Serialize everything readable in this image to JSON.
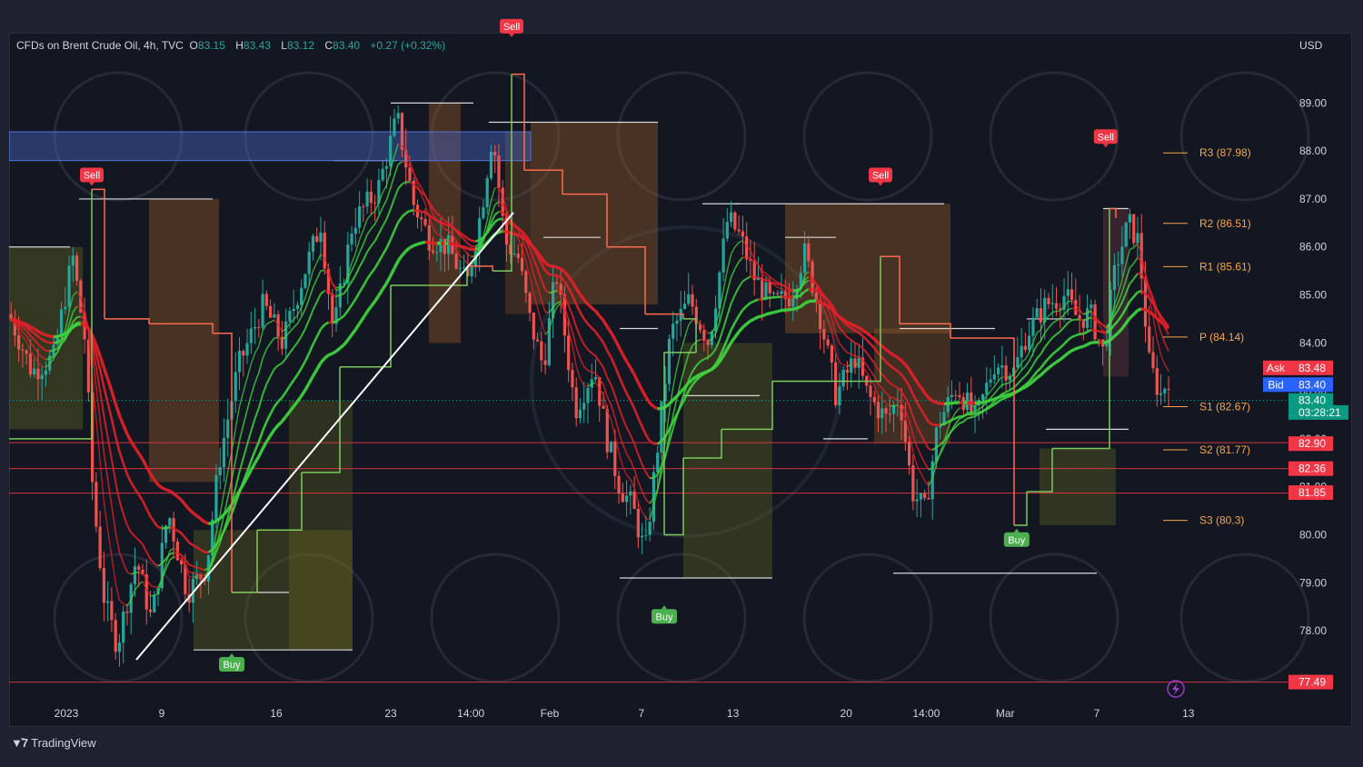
{
  "header": {
    "symbol": "CFDs on Brent Crude Oil, 4h, TVC",
    "open_label": "O",
    "open": "83.15",
    "high_label": "H",
    "high": "83.43",
    "low_label": "L",
    "low": "83.12",
    "close_label": "C",
    "close": "83.40",
    "change": "+0.27 (+0.32%)",
    "currency": "USD"
  },
  "footer": {
    "brand": "TradingView"
  },
  "colors": {
    "background": "#131722",
    "up": "#26a69a",
    "down": "#ef5350",
    "ema_green": "#3fd23f",
    "ema_red": "#e0202a",
    "pivot": "#f7a44a"
  },
  "chart_data": {
    "type": "candlestick",
    "ylim": [
      76.6,
      90.2
    ],
    "y_ticks": [
      77,
      78,
      79,
      80,
      81,
      82,
      83,
      84,
      85,
      86,
      87,
      88,
      89
    ],
    "y_tick_labels": [
      "77.00",
      "78.00",
      "79.00",
      "80.00",
      "81.00",
      "82.00",
      "83.00",
      "84.00",
      "85.00",
      "86.00",
      "87.00",
      "88.00",
      "89.00"
    ],
    "x_ticks": [
      {
        "label": "2023",
        "t": 0.045
      },
      {
        "label": "9",
        "t": 0.12
      },
      {
        "label": "16",
        "t": 0.21
      },
      {
        "label": "23",
        "t": 0.3
      },
      {
        "label": "14:00",
        "t": 0.363
      },
      {
        "label": "Feb",
        "t": 0.425
      },
      {
        "label": "7",
        "t": 0.497
      },
      {
        "label": "13",
        "t": 0.569
      },
      {
        "label": "20",
        "t": 0.658
      },
      {
        "label": "14:00",
        "t": 0.721
      },
      {
        "label": "Mar",
        "t": 0.783
      },
      {
        "label": "7",
        "t": 0.855
      },
      {
        "label": "13",
        "t": 0.927
      }
    ],
    "price_path": [
      [
        0.0,
        84.6
      ],
      [
        0.018,
        83.4
      ],
      [
        0.035,
        83.7
      ],
      [
        0.05,
        85.8
      ],
      [
        0.06,
        84.0
      ],
      [
        0.066,
        80.8
      ],
      [
        0.075,
        78.6
      ],
      [
        0.085,
        77.7
      ],
      [
        0.1,
        79.5
      ],
      [
        0.112,
        78.2
      ],
      [
        0.125,
        80.5
      ],
      [
        0.14,
        78.8
      ],
      [
        0.155,
        79.3
      ],
      [
        0.165,
        81.5
      ],
      [
        0.18,
        83.5
      ],
      [
        0.2,
        84.8
      ],
      [
        0.215,
        84.0
      ],
      [
        0.23,
        85.3
      ],
      [
        0.245,
        86.5
      ],
      [
        0.255,
        84.2
      ],
      [
        0.27,
        86.5
      ],
      [
        0.29,
        87.2
      ],
      [
        0.305,
        88.7
      ],
      [
        0.318,
        86.9
      ],
      [
        0.33,
        86.2
      ],
      [
        0.345,
        86.0
      ],
      [
        0.36,
        85.2
      ],
      [
        0.372,
        86.9
      ],
      [
        0.38,
        88.4
      ],
      [
        0.39,
        86.1
      ],
      [
        0.4,
        85.8
      ],
      [
        0.41,
        84.4
      ],
      [
        0.42,
        83.5
      ],
      [
        0.43,
        85.5
      ],
      [
        0.445,
        82.6
      ],
      [
        0.46,
        83.5
      ],
      [
        0.47,
        82.0
      ],
      [
        0.48,
        81.0
      ],
      [
        0.49,
        80.6
      ],
      [
        0.5,
        79.6
      ],
      [
        0.51,
        81.9
      ],
      [
        0.52,
        84.2
      ],
      [
        0.535,
        84.9
      ],
      [
        0.55,
        84.0
      ],
      [
        0.565,
        86.6
      ],
      [
        0.575,
        86.2
      ],
      [
        0.585,
        85.4
      ],
      [
        0.6,
        84.8
      ],
      [
        0.615,
        85.0
      ],
      [
        0.625,
        85.9
      ],
      [
        0.635,
        84.9
      ],
      [
        0.65,
        82.9
      ],
      [
        0.665,
        83.7
      ],
      [
        0.675,
        82.9
      ],
      [
        0.69,
        82.4
      ],
      [
        0.7,
        82.9
      ],
      [
        0.71,
        80.9
      ],
      [
        0.72,
        80.5
      ],
      [
        0.73,
        82.3
      ],
      [
        0.745,
        83.1
      ],
      [
        0.76,
        82.4
      ],
      [
        0.775,
        83.6
      ],
      [
        0.79,
        83.4
      ],
      [
        0.8,
        84.2
      ],
      [
        0.815,
        84.8
      ],
      [
        0.83,
        85.0
      ],
      [
        0.84,
        84.5
      ],
      [
        0.85,
        84.6
      ],
      [
        0.86,
        83.8
      ],
      [
        0.87,
        85.6
      ],
      [
        0.88,
        86.5
      ],
      [
        0.888,
        86.1
      ],
      [
        0.896,
        83.6
      ],
      [
        0.905,
        82.9
      ],
      [
        0.913,
        83.4
      ]
    ],
    "price_tags": [
      {
        "label": "Ask",
        "value": "83.48",
        "y": 83.48,
        "color": "#f23645"
      },
      {
        "label": "Bid",
        "value": "83.40",
        "y": 83.13,
        "color": "#2962ff"
      },
      {
        "label": "",
        "value": "83.40",
        "y": 82.8,
        "color": "#089981"
      },
      {
        "label": "",
        "value": "03:28:21",
        "y": 82.55,
        "color": "#089981"
      },
      {
        "label": "",
        "value": "82.90",
        "y": 81.9,
        "color": "#f23645"
      },
      {
        "label": "",
        "value": "82.36",
        "y": 81.38,
        "color": "#f23645"
      },
      {
        "label": "",
        "value": "81.85",
        "y": 80.88,
        "color": "#f23645"
      },
      {
        "label": "",
        "value": "77.49",
        "y": 76.93,
        "color": "#f23645"
      }
    ],
    "horizontal_lines": [
      {
        "y": 82.9,
        "color": "#f23645"
      },
      {
        "y": 82.36,
        "color": "#f23645"
      },
      {
        "y": 81.85,
        "color": "#f23645"
      },
      {
        "y": 77.49,
        "color": "#f23645"
      }
    ],
    "pivots": [
      {
        "label": "R3 (87.98)",
        "y": 87.98
      },
      {
        "label": "R2 (86.51)",
        "y": 86.51
      },
      {
        "label": "R1 (85.61)",
        "y": 85.61
      },
      {
        "label": "P (84.14)",
        "y": 84.14
      },
      {
        "label": "S1 (82.67)",
        "y": 82.67
      },
      {
        "label": "S2 (81.77)",
        "y": 81.77
      },
      {
        "label": "S3 (80.3)",
        "y": 80.3
      }
    ],
    "signals": [
      {
        "label": "Sell",
        "t": 0.065,
        "y": 87.5,
        "type": "sell"
      },
      {
        "label": "Sell",
        "t": 0.395,
        "y": 90.6,
        "type": "sell"
      },
      {
        "label": "Buy",
        "t": 0.175,
        "y": 77.3,
        "type": "buy"
      },
      {
        "label": "Buy",
        "t": 0.515,
        "y": 78.3,
        "type": "buy"
      },
      {
        "label": "Sell",
        "t": 0.685,
        "y": 87.5,
        "type": "sell"
      },
      {
        "label": "Buy",
        "t": 0.792,
        "y": 79.9,
        "type": "buy"
      },
      {
        "label": "Sell",
        "t": 0.862,
        "y": 88.3,
        "type": "sell"
      }
    ],
    "supply_zone": {
      "y1": 87.8,
      "y2": 88.4,
      "t1": 0.0,
      "t2": 0.41
    }
  }
}
